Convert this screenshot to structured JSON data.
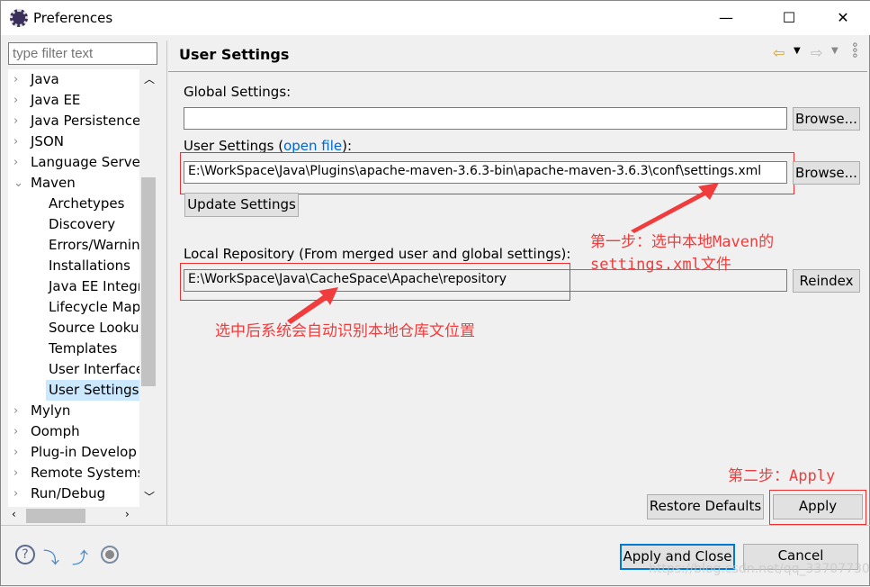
{
  "window": {
    "title": "Preferences",
    "minimize": "—",
    "maximize": "☐",
    "close": "✕"
  },
  "filter": {
    "placeholder": "type filter text"
  },
  "tree": [
    {
      "label": "Java",
      "expanded": false,
      "level": 0
    },
    {
      "label": "Java EE",
      "expanded": false,
      "level": 0
    },
    {
      "label": "Java Persistence",
      "expanded": false,
      "level": 0
    },
    {
      "label": "JSON",
      "expanded": false,
      "level": 0
    },
    {
      "label": "Language Server",
      "expanded": false,
      "level": 0
    },
    {
      "label": "Maven",
      "expanded": true,
      "level": 0
    },
    {
      "label": "Archetypes",
      "level": 1
    },
    {
      "label": "Discovery",
      "level": 1
    },
    {
      "label": "Errors/Warnin",
      "level": 1
    },
    {
      "label": "Installations",
      "level": 1
    },
    {
      "label": "Java EE Integra",
      "level": 1
    },
    {
      "label": "Lifecycle Map",
      "level": 1
    },
    {
      "label": "Source Looku",
      "level": 1
    },
    {
      "label": "Templates",
      "level": 1
    },
    {
      "label": "User Interface",
      "level": 1
    },
    {
      "label": "User Settings",
      "level": 1,
      "selected": true
    },
    {
      "label": "Mylyn",
      "expanded": false,
      "level": 0
    },
    {
      "label": "Oomph",
      "expanded": false,
      "level": 0
    },
    {
      "label": "Plug-in Develop",
      "expanded": false,
      "level": 0
    },
    {
      "label": "Remote Systems",
      "expanded": false,
      "level": 0
    },
    {
      "label": "Run/Debug",
      "expanded": false,
      "level": 0
    }
  ],
  "page": {
    "title": "User Settings",
    "global_label": "Global Settings:",
    "global_value": "",
    "browse1": "Browse...",
    "user_label": "User Settings (",
    "open_file": "open file",
    "user_label_end": "):",
    "user_value": "E:\\WorkSpace\\Java\\Plugins\\apache-maven-3.6.3-bin\\apache-maven-3.6.3\\conf\\settings.xml",
    "browse2": "Browse...",
    "update": "Update Settings",
    "local_label": "Local Repository (From merged user and global settings):",
    "local_value": "E:\\WorkSpace\\Java\\CacheSpace\\Apache\\repository",
    "reindex": "Reindex",
    "restore": "Restore Defaults",
    "apply": "Apply"
  },
  "annotations": {
    "step1_line1": "第一步：选中本地Maven的",
    "step1_line2": "settings.xml文件",
    "local_note": "选中后系统会自动识别本地仓库文位置",
    "step2": "第二步：Apply",
    "color": "#f03c3c"
  },
  "footer": {
    "apply_close": "Apply and Close",
    "cancel": "Cancel",
    "watermark": "https://blog.csdn.net/qq_33707730"
  }
}
